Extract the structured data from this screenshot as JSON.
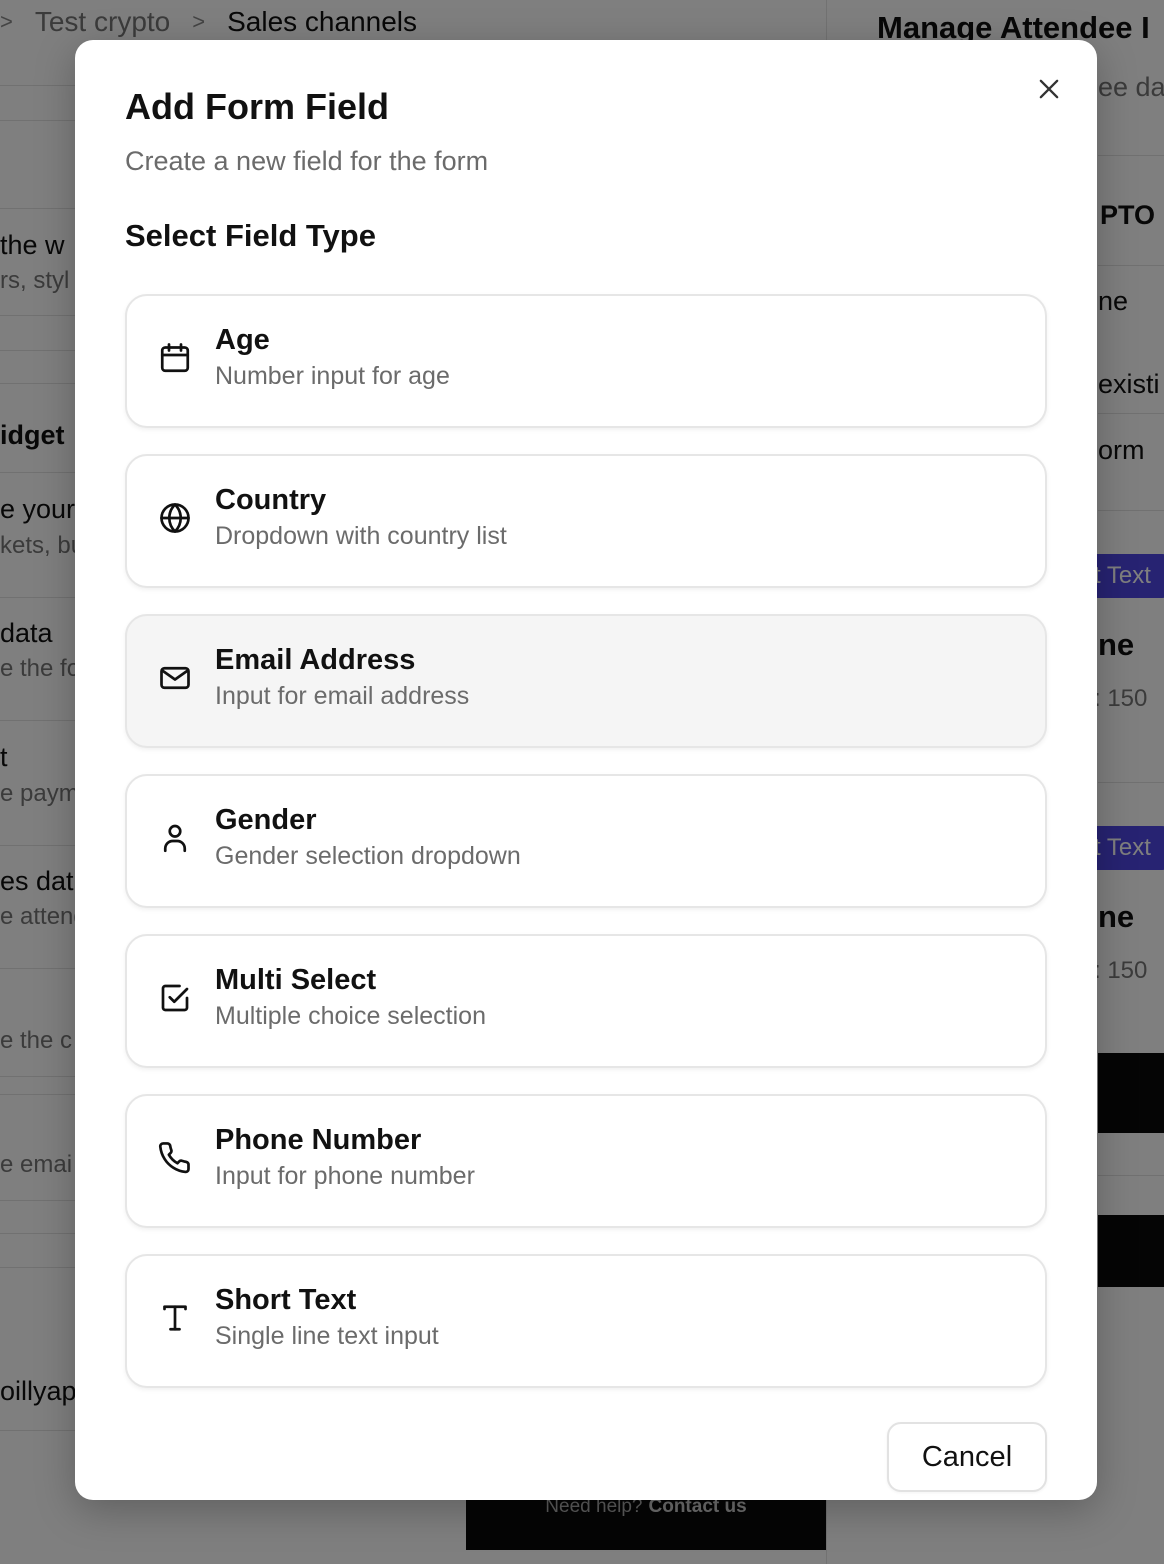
{
  "background": {
    "breadcrumb": {
      "lead_sep": ">",
      "items": [
        "Test crypto",
        "Sales channels"
      ],
      "separator": ">"
    },
    "left_fragments": [
      {
        "t": "the w",
        "s": "rs, styl"
      },
      {
        "t": "idget",
        "s": ""
      },
      {
        "t": "e your",
        "s": "kets, bu"
      },
      {
        "t": "data",
        "s": "e the fo"
      },
      {
        "t": "t",
        "s": "e paym"
      },
      {
        "t": "es dat",
        "s": "e attend"
      },
      {
        "t": "",
        "s": "e the c"
      },
      {
        "t": "",
        "s": "e emai"
      },
      {
        "t": "oillyap",
        "s": ""
      }
    ],
    "right_panel": {
      "title": "Manage Attendee I",
      "sub": "ee da",
      "fragments": [
        "PTO",
        "ne",
        "existi",
        "orm",
        "ne",
        ": 150",
        "ne",
        ": 150"
      ],
      "badges": [
        "t Text",
        "t Text"
      ]
    },
    "help": {
      "text": "Need help?",
      "link": "Contact us"
    }
  },
  "modal": {
    "title": "Add Form Field",
    "subtitle": "Create a new field for the form",
    "section_title": "Select Field Type",
    "options": [
      {
        "label": "Age",
        "description": "Number input for age",
        "icon": "calendar-icon"
      },
      {
        "label": "Country",
        "description": "Dropdown with country list",
        "icon": "globe-icon"
      },
      {
        "label": "Email Address",
        "description": "Input for email address",
        "icon": "mail-icon"
      },
      {
        "label": "Gender",
        "description": "Gender selection dropdown",
        "icon": "user-icon"
      },
      {
        "label": "Multi Select",
        "description": "Multiple choice selection",
        "icon": "checkbox-icon"
      },
      {
        "label": "Phone Number",
        "description": "Input for phone number",
        "icon": "phone-icon"
      },
      {
        "label": "Short Text",
        "description": "Single line text input",
        "icon": "text-icon"
      }
    ],
    "cancel_label": "Cancel",
    "close_icon": "close-icon"
  },
  "colors": {
    "overlay": "rgba(0,0,0,0.5)",
    "badge": "#4f46e5",
    "hover_option": "#f5f5f5"
  }
}
